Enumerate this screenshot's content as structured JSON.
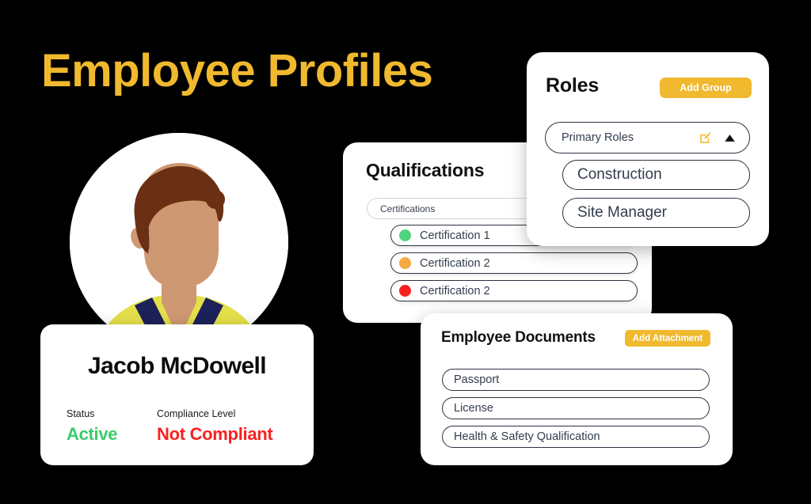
{
  "page": {
    "title": "Employee Profiles",
    "title_color": "#F0B92E",
    "background_color": "#000000"
  },
  "avatar": {
    "name": "employee-avatar",
    "hair_color": "#6B2F14",
    "skin_color": "#CE9872",
    "shirt_color": "#E4E04A",
    "collar_color": "#1C2159",
    "circle_color": "#FFFFFF"
  },
  "profile_card": {
    "name": "Jacob McDowell",
    "status_label": "Status",
    "status_value": "Active",
    "status_color": "#3ACB6A",
    "compliance_label": "Compliance Level",
    "compliance_value": "Not Compliant",
    "compliance_color": "#FA2020"
  },
  "qualifications_card": {
    "title": "Qualifications",
    "group_label": "Certifications",
    "certifications": [
      {
        "label": "Certification 1",
        "dot_color": "#4ED47E"
      },
      {
        "label": "Certification 2",
        "dot_color": "#F5A93F"
      },
      {
        "label": "Certification 2",
        "dot_color": "#FA2020"
      }
    ]
  },
  "roles_card": {
    "title": "Roles",
    "add_button_label": "Add Group",
    "group_label": "Primary Roles",
    "edit_icon": "edit-square-icon",
    "collapse_icon": "triangle-up-icon",
    "roles": [
      "Construction",
      "Site Manager"
    ]
  },
  "documents_card": {
    "title": "Employee Documents",
    "add_button_label": "Add Attachment",
    "documents": [
      "Passport",
      "License",
      "Health & Safety Qualification"
    ]
  },
  "theme": {
    "accent": "#F0B92E",
    "text_dark": "#333D4D"
  }
}
